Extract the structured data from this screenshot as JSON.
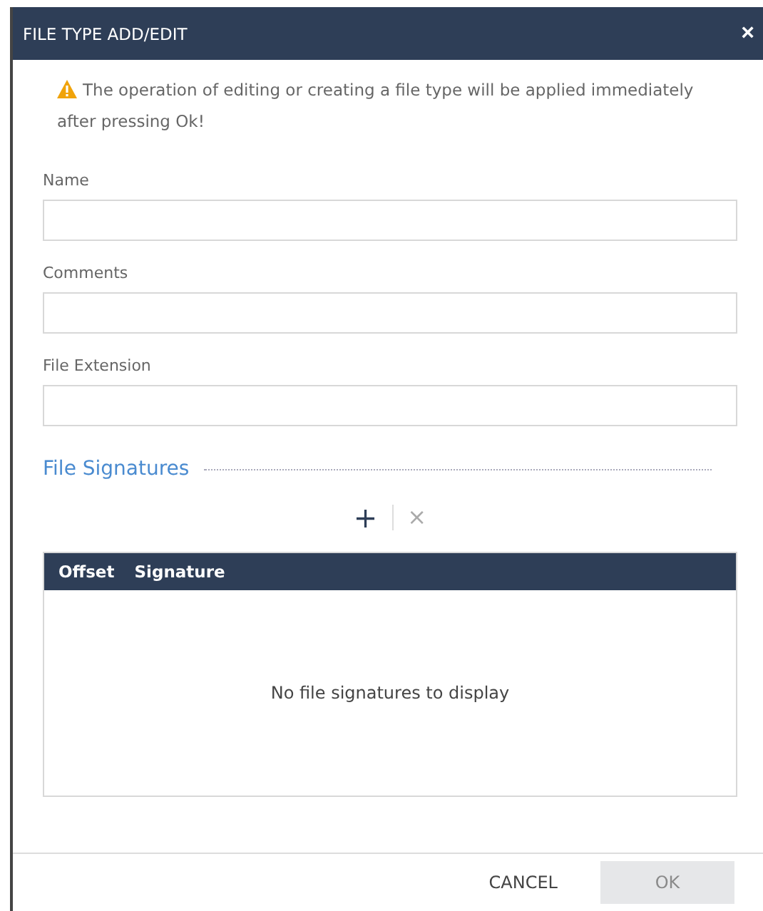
{
  "window": {
    "title": "FILE TYPE ADD/EDIT",
    "close": "×"
  },
  "warning": "The operation of editing or creating a file type will be applied immediately after pressing Ok!",
  "fields": [
    {
      "label": "Name"
    },
    {
      "label": "Comments"
    },
    {
      "label": "File Extension"
    }
  ],
  "section": {
    "title": "File Signatures"
  },
  "toolbar": [
    {
      "kind": "add",
      "label": "+",
      "disabled": false
    },
    {
      "kind": "delete",
      "label": "×",
      "disabled": true
    }
  ],
  "table": {
    "columns": [
      "Offset",
      "Signature"
    ],
    "empty_message": "No file signatures to display"
  },
  "buttons": [
    {
      "label": "CANCEL",
      "kind": "flat",
      "disabled": false
    },
    {
      "label": "OK",
      "kind": "primary",
      "disabled": true
    }
  ]
}
